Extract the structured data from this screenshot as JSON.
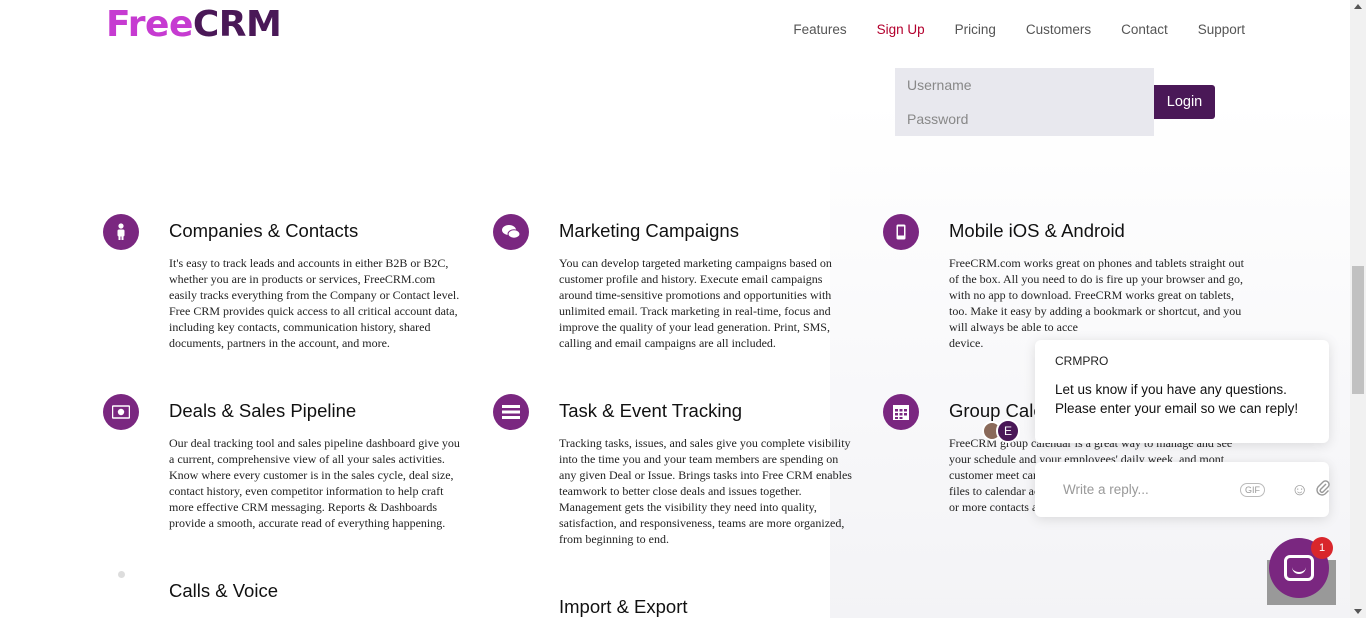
{
  "header": {
    "logo_free": "Free",
    "logo_crm": "CRM",
    "nav": [
      "Features",
      "Sign Up",
      "Pricing",
      "Customers",
      "Contact",
      "Support"
    ],
    "active_nav": "Sign Up"
  },
  "login": {
    "username_placeholder": "Username",
    "password_placeholder": "Password",
    "button_label": "Login"
  },
  "features": [
    {
      "icon": "person-icon",
      "title": "Companies & Contacts",
      "text": "It's easy to track leads and accounts in either B2B or B2C, whether you are in products or services, FreeCRM.com easily tracks everything from the Company or Contact level. Free CRM provides quick access to all critical account data, including key contacts, communication history, shared documents, partners in the account, and more."
    },
    {
      "icon": "chat-bubbles-icon",
      "title": "Marketing Campaigns",
      "text": "You can develop targeted marketing campaigns based on customer profile and history. Execute email campaigns around time-sensitive promotions and opportunities with unlimited email. Track marketing in real-time, focus and improve the quality of your lead generation. Print, SMS, calling and email campaigns are all included."
    },
    {
      "icon": "mobile-phone-icon",
      "title": "Mobile iOS & Android",
      "text": "FreeCRM.com works great on phones and tablets straight out of the box. All you need to do is fire up your browser and go, with no app to download. FreeCRM works great on tablets, too. Make it easy by adding a bookmark or shortcut, and you will always be able to acce"
    },
    {
      "icon": "money-icon",
      "title": "Deals & Sales Pipeline",
      "text": "Our deal tracking tool and sales pipeline dashboard give you a current, comprehensive view of all your sales activities. Know where every customer is in the sales cycle, deal size, contact history, even competitor information to help craft more effective CRM messaging. Reports & Dashboards provide a smooth, accurate read of everything happening."
    },
    {
      "icon": "task-list-icon",
      "title": "Task & Event Tracking",
      "text": "Tracking tasks, issues, and sales give you complete visibility into the time you and your team members are spending on any given Deal or Issue. Brings tasks into Free CRM enables teamwork to better close deals and issues together. Management gets the visibility they need into quality, satisfaction, and responsiveness, teams are more organized, from beginning to end."
    },
    {
      "icon": "calendar-icon",
      "title": "Group Cale",
      "text": "FreeCRM group calendar is a great way to manage and see your schedule and your employees' daily week, and mont customer meet can track upcom tasks and enter notes, attach files to calendar activities, associate calendar entries with one or more contacts and assign tasks to one or more co-workers."
    },
    {
      "icon": "phone-icon",
      "title": "Calls & Voice",
      "text": ""
    },
    {
      "icon": "import-export-icon",
      "title": "Import & Export",
      "text": ""
    }
  ],
  "mobile_tail": "device.",
  "chat": {
    "sender": "CRMPRO",
    "message": "Let us know if you have any questions. Please enter your email so we can reply!",
    "avatar_letter": "E",
    "reply_placeholder": "Write a reply...",
    "gif_label": "GIF",
    "badge_count": "1"
  }
}
